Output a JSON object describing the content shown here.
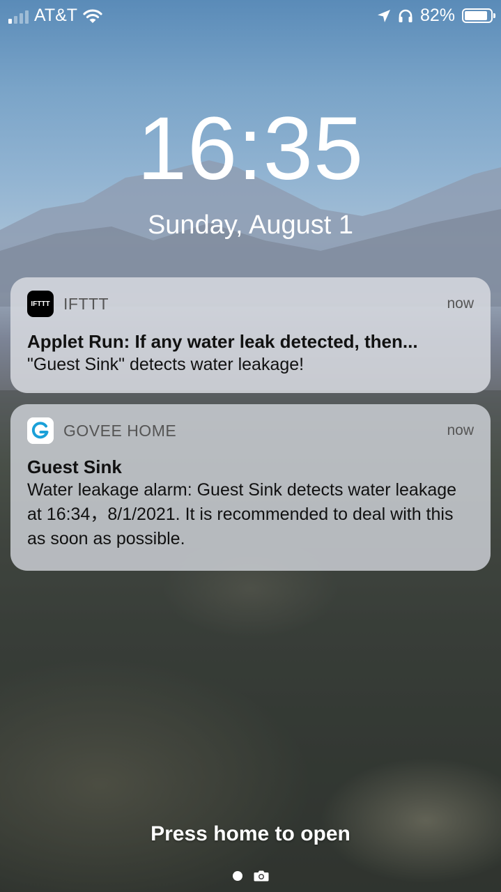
{
  "status_bar": {
    "carrier": "AT&T",
    "battery": "82%",
    "signal_icon": "signal-bars-icon",
    "wifi_icon": "wifi-icon",
    "location_icon": "location-arrow-icon",
    "headphones_icon": "headphones-icon",
    "battery_icon": "battery-icon"
  },
  "lock": {
    "time": "16:35",
    "date": "Sunday, August 1"
  },
  "notifications": [
    {
      "app_icon": "ifttt-icon",
      "app_icon_text": "IFTTT",
      "app": "IFTTT",
      "time": "now",
      "title": "Applet Run: If any water leak detected, then...",
      "body": "\"Guest Sink\" detects water leakage!"
    },
    {
      "app_icon": "govee-icon",
      "app_icon_text": "G",
      "app": "GOVEE HOME",
      "time": "now",
      "title": "Guest Sink",
      "body": "Water leakage alarm: Guest Sink detects water leakage at 16:34，8/1/2021. It is recommended to deal with this as soon as possible."
    }
  ],
  "footer": {
    "prompt": "Press home to open",
    "page_dot_icon": "page-dot-icon",
    "camera_icon": "camera-icon"
  },
  "colors": {
    "govee_accent": "#1aa0d8",
    "ifttt_bg": "#000000"
  }
}
